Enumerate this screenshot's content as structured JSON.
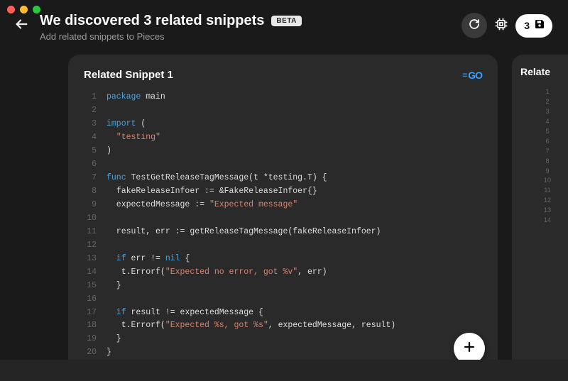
{
  "header": {
    "title": "We discovered 3 related snippets",
    "badge": "BETA",
    "subtitle": "Add related snippets to Pieces",
    "save_count": "3"
  },
  "card1": {
    "title": "Related Snippet 1",
    "language": "GO",
    "line_count": 20,
    "code_html": "<span class=\"tok-kw\">package</span><span class=\"tok-plain\"> main</span>\n\n<span class=\"tok-kw\">import</span><span class=\"tok-plain\"> (</span>\n<span class=\"tok-plain\">  </span><span class=\"tok-str\">\"testing\"</span>\n<span class=\"tok-plain\">)</span>\n\n<span class=\"tok-kw\">func</span><span class=\"tok-plain\"> TestGetReleaseTagMessage(t *testing.T) {</span>\n<span class=\"tok-plain\">  fakeReleaseInfoer := &amp;FakeReleaseInfoer{}</span>\n<span class=\"tok-plain\">  expectedMessage := </span><span class=\"tok-str\">\"Expected message\"</span>\n\n<span class=\"tok-plain\">  result, err := getReleaseTagMessage(fakeReleaseInfoer)</span>\n\n<span class=\"tok-plain\">  </span><span class=\"tok-kw\">if</span><span class=\"tok-plain\"> err != </span><span class=\"tok-builtin\">nil</span><span class=\"tok-plain\"> {</span>\n<span class=\"tok-plain\">   t.Errorf(</span><span class=\"tok-str\">\"Expected no error, got %v\"</span><span class=\"tok-plain\">, err)</span>\n<span class=\"tok-plain\">  }</span>\n\n<span class=\"tok-plain\">  </span><span class=\"tok-kw\">if</span><span class=\"tok-plain\"> result != expectedMessage {</span>\n<span class=\"tok-plain\">   t.Errorf(</span><span class=\"tok-str\">\"Expected %s, got %s\"</span><span class=\"tok-plain\">, expectedMessage, result)</span>\n<span class=\"tok-plain\">  }</span>\n<span class=\"tok-plain\">}</span>"
  },
  "card2": {
    "title_partial": "Relate",
    "line_count": 14
  }
}
